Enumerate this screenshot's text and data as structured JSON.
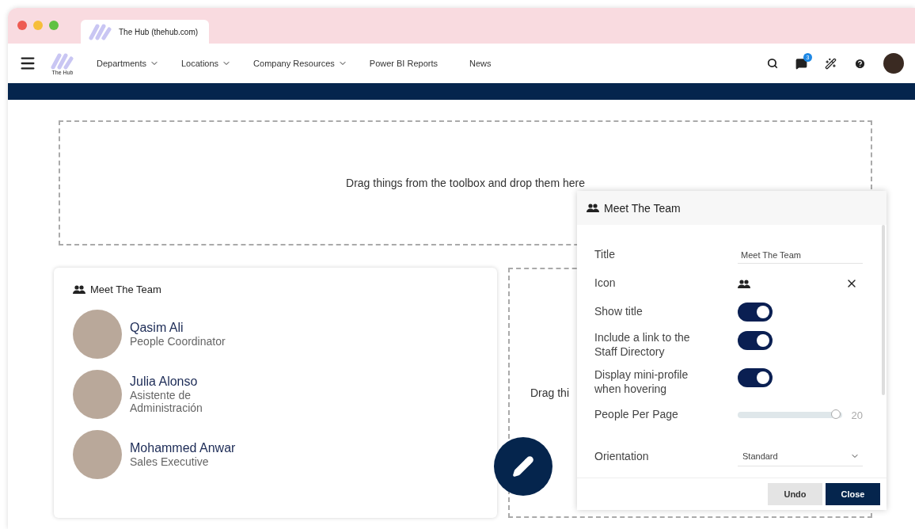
{
  "browser": {
    "tab_title": "The Hub (thehub.com)"
  },
  "nav": {
    "logo_text": "The Hub",
    "items": [
      {
        "label": "Departments",
        "dropdown": true
      },
      {
        "label": "Locations",
        "dropdown": true
      },
      {
        "label": "Company Resources",
        "dropdown": true
      },
      {
        "label": "Power BI Reports",
        "dropdown": false
      },
      {
        "label": "News",
        "dropdown": false
      }
    ],
    "notification_count": "3"
  },
  "drop_zone": {
    "text": "Drag things from the toolbox and drop them here"
  },
  "team_card": {
    "title": "Meet The Team",
    "people": [
      {
        "name": "Qasim Ali",
        "role": "People Coordinator"
      },
      {
        "name": "Julia Alonso",
        "role": "Asistente de Administración"
      },
      {
        "name": "Mohammed Anwar",
        "role": "Sales Executive"
      }
    ]
  },
  "drop_zone_2": {
    "text": "Drag thi"
  },
  "settings_panel": {
    "title": "Meet The Team",
    "fields": [
      {
        "kind": "text",
        "label": "Title",
        "value": "Meet The Team"
      },
      {
        "kind": "icon",
        "label": "Icon"
      },
      {
        "kind": "toggle",
        "label": "Show title",
        "on": true
      },
      {
        "kind": "toggle",
        "label": "Include a link to the Staff Directory",
        "on": true
      },
      {
        "kind": "toggle",
        "label": "Display mini-profile when hovering",
        "on": true
      },
      {
        "kind": "slider",
        "label": "People Per Page",
        "level": 0.95,
        "reading": "20"
      },
      {
        "kind": "select",
        "label": "Orientation",
        "value": "Standard"
      }
    ],
    "buttons": [
      {
        "label": "Undo",
        "kind": "secondary"
      },
      {
        "label": "Close",
        "kind": "primary"
      }
    ]
  }
}
